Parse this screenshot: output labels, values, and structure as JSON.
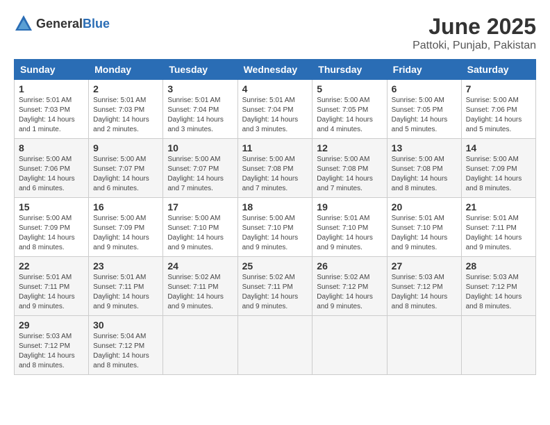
{
  "header": {
    "logo_general": "General",
    "logo_blue": "Blue",
    "title": "June 2025",
    "subtitle": "Pattoki, Punjab, Pakistan"
  },
  "calendar": {
    "days_of_week": [
      "Sunday",
      "Monday",
      "Tuesday",
      "Wednesday",
      "Thursday",
      "Friday",
      "Saturday"
    ],
    "weeks": [
      [
        null,
        {
          "day": "2",
          "sunrise": "Sunrise: 5:01 AM",
          "sunset": "Sunset: 7:03 PM",
          "daylight": "Daylight: 14 hours and 2 minutes."
        },
        {
          "day": "3",
          "sunrise": "Sunrise: 5:01 AM",
          "sunset": "Sunset: 7:04 PM",
          "daylight": "Daylight: 14 hours and 3 minutes."
        },
        {
          "day": "4",
          "sunrise": "Sunrise: 5:01 AM",
          "sunset": "Sunset: 7:04 PM",
          "daylight": "Daylight: 14 hours and 3 minutes."
        },
        {
          "day": "5",
          "sunrise": "Sunrise: 5:00 AM",
          "sunset": "Sunset: 7:05 PM",
          "daylight": "Daylight: 14 hours and 4 minutes."
        },
        {
          "day": "6",
          "sunrise": "Sunrise: 5:00 AM",
          "sunset": "Sunset: 7:05 PM",
          "daylight": "Daylight: 14 hours and 5 minutes."
        },
        {
          "day": "7",
          "sunrise": "Sunrise: 5:00 AM",
          "sunset": "Sunset: 7:06 PM",
          "daylight": "Daylight: 14 hours and 5 minutes."
        }
      ],
      [
        {
          "day": "1",
          "sunrise": "Sunrise: 5:01 AM",
          "sunset": "Sunset: 7:03 PM",
          "daylight": "Daylight: 14 hours and 1 minute."
        },
        null,
        null,
        null,
        null,
        null,
        null
      ],
      [
        {
          "day": "8",
          "sunrise": "Sunrise: 5:00 AM",
          "sunset": "Sunset: 7:06 PM",
          "daylight": "Daylight: 14 hours and 6 minutes."
        },
        {
          "day": "9",
          "sunrise": "Sunrise: 5:00 AM",
          "sunset": "Sunset: 7:07 PM",
          "daylight": "Daylight: 14 hours and 6 minutes."
        },
        {
          "day": "10",
          "sunrise": "Sunrise: 5:00 AM",
          "sunset": "Sunset: 7:07 PM",
          "daylight": "Daylight: 14 hours and 7 minutes."
        },
        {
          "day": "11",
          "sunrise": "Sunrise: 5:00 AM",
          "sunset": "Sunset: 7:08 PM",
          "daylight": "Daylight: 14 hours and 7 minutes."
        },
        {
          "day": "12",
          "sunrise": "Sunrise: 5:00 AM",
          "sunset": "Sunset: 7:08 PM",
          "daylight": "Daylight: 14 hours and 7 minutes."
        },
        {
          "day": "13",
          "sunrise": "Sunrise: 5:00 AM",
          "sunset": "Sunset: 7:08 PM",
          "daylight": "Daylight: 14 hours and 8 minutes."
        },
        {
          "day": "14",
          "sunrise": "Sunrise: 5:00 AM",
          "sunset": "Sunset: 7:09 PM",
          "daylight": "Daylight: 14 hours and 8 minutes."
        }
      ],
      [
        {
          "day": "15",
          "sunrise": "Sunrise: 5:00 AM",
          "sunset": "Sunset: 7:09 PM",
          "daylight": "Daylight: 14 hours and 8 minutes."
        },
        {
          "day": "16",
          "sunrise": "Sunrise: 5:00 AM",
          "sunset": "Sunset: 7:09 PM",
          "daylight": "Daylight: 14 hours and 9 minutes."
        },
        {
          "day": "17",
          "sunrise": "Sunrise: 5:00 AM",
          "sunset": "Sunset: 7:10 PM",
          "daylight": "Daylight: 14 hours and 9 minutes."
        },
        {
          "day": "18",
          "sunrise": "Sunrise: 5:00 AM",
          "sunset": "Sunset: 7:10 PM",
          "daylight": "Daylight: 14 hours and 9 minutes."
        },
        {
          "day": "19",
          "sunrise": "Sunrise: 5:01 AM",
          "sunset": "Sunset: 7:10 PM",
          "daylight": "Daylight: 14 hours and 9 minutes."
        },
        {
          "day": "20",
          "sunrise": "Sunrise: 5:01 AM",
          "sunset": "Sunset: 7:10 PM",
          "daylight": "Daylight: 14 hours and 9 minutes."
        },
        {
          "day": "21",
          "sunrise": "Sunrise: 5:01 AM",
          "sunset": "Sunset: 7:11 PM",
          "daylight": "Daylight: 14 hours and 9 minutes."
        }
      ],
      [
        {
          "day": "22",
          "sunrise": "Sunrise: 5:01 AM",
          "sunset": "Sunset: 7:11 PM",
          "daylight": "Daylight: 14 hours and 9 minutes."
        },
        {
          "day": "23",
          "sunrise": "Sunrise: 5:01 AM",
          "sunset": "Sunset: 7:11 PM",
          "daylight": "Daylight: 14 hours and 9 minutes."
        },
        {
          "day": "24",
          "sunrise": "Sunrise: 5:02 AM",
          "sunset": "Sunset: 7:11 PM",
          "daylight": "Daylight: 14 hours and 9 minutes."
        },
        {
          "day": "25",
          "sunrise": "Sunrise: 5:02 AM",
          "sunset": "Sunset: 7:11 PM",
          "daylight": "Daylight: 14 hours and 9 minutes."
        },
        {
          "day": "26",
          "sunrise": "Sunrise: 5:02 AM",
          "sunset": "Sunset: 7:12 PM",
          "daylight": "Daylight: 14 hours and 9 minutes."
        },
        {
          "day": "27",
          "sunrise": "Sunrise: 5:03 AM",
          "sunset": "Sunset: 7:12 PM",
          "daylight": "Daylight: 14 hours and 8 minutes."
        },
        {
          "day": "28",
          "sunrise": "Sunrise: 5:03 AM",
          "sunset": "Sunset: 7:12 PM",
          "daylight": "Daylight: 14 hours and 8 minutes."
        }
      ],
      [
        {
          "day": "29",
          "sunrise": "Sunrise: 5:03 AM",
          "sunset": "Sunset: 7:12 PM",
          "daylight": "Daylight: 14 hours and 8 minutes."
        },
        {
          "day": "30",
          "sunrise": "Sunrise: 5:04 AM",
          "sunset": "Sunset: 7:12 PM",
          "daylight": "Daylight: 14 hours and 8 minutes."
        },
        null,
        null,
        null,
        null,
        null
      ]
    ]
  }
}
